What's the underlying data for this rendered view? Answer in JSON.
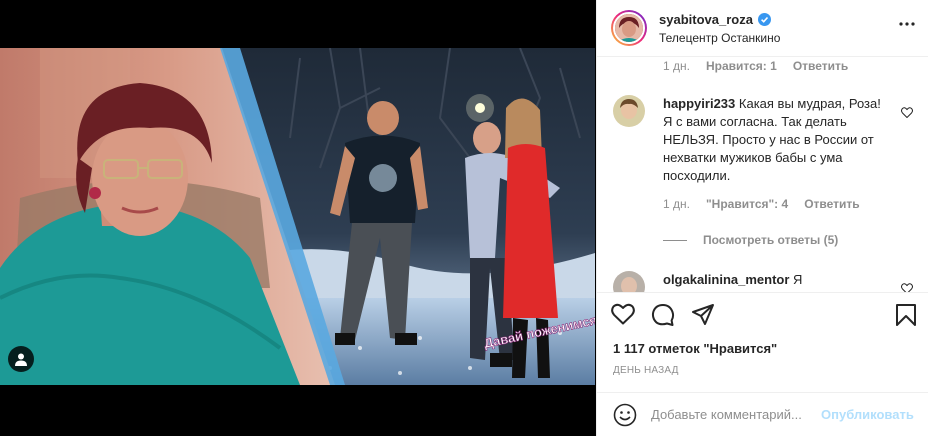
{
  "post": {
    "username": "syabitova_roza",
    "location": "Телецентр Останкино",
    "show_logo": "Давай поженимся"
  },
  "colors": {
    "verified": "#3897f0",
    "publish_disabled": "#b2dffc",
    "muted": "#8e8e8e"
  },
  "comments": {
    "prev_meta": {
      "age": "1 дн.",
      "likes": "Нравится: 1",
      "reply": "Ответить"
    },
    "items": [
      {
        "user": "happyiri233",
        "text": "Какая вы мудрая, Роза! Я с вами согласна. Так делать НЕЛЬЗЯ. Просто у нас в России от нехватки мужиков бабы с ума посходили.",
        "age": "1 дн.",
        "likes": "\"Нравится\": 4",
        "reply": "Ответить",
        "view_replies": "Посмотреть ответы (5)"
      },
      {
        "user": "olgakalinina_mentor",
        "text": "Я"
      }
    ]
  },
  "actions": {
    "like_icon": "heart-icon",
    "comment_icon": "comment-icon",
    "share_icon": "share-icon",
    "save_icon": "bookmark-icon",
    "likes_text": "1 117 отметок \"Нравится\"",
    "time_text": "ДЕНЬ НАЗАД"
  },
  "add_comment": {
    "placeholder": "Добавьте комментарий...",
    "publish_label": "Опубликовать"
  }
}
